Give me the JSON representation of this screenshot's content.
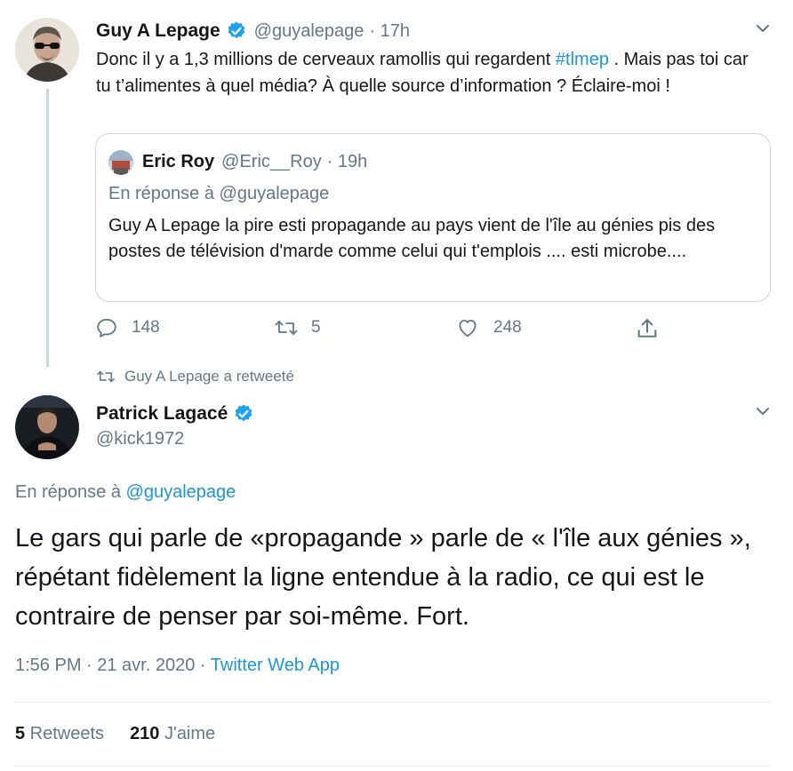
{
  "tweet1": {
    "author_name": "Guy A Lepage",
    "handle": "@guyalepage",
    "time": "· 17h",
    "text_part1": "Donc il y a 1,3 millions de cerveaux ramollis qui regardent ",
    "hashtag": "#tlmep",
    "text_part2": " . Mais pas toi car tu t’alimentes à quel média? À quelle source d’information ? Éclaire-moi !",
    "quote": {
      "author_name": "Eric Roy",
      "handle": "@Eric__Roy",
      "time": "· 19h",
      "reply_to_prefix": "En réponse à ",
      "reply_to_handle": "@guyalepage",
      "text": "Guy A Lepage la pire esti propagande au pays vient de l'île au génies pis des postes de télévision d'marde comme celui qui t'emplois .... esti microbe...."
    },
    "actions": {
      "replies": "148",
      "retweets": "5",
      "likes": "248"
    }
  },
  "retweet_notice": "Guy A Lepage a retweeté",
  "tweet2": {
    "author_name": "Patrick Lagacé",
    "handle": "@kick1972",
    "reply_to_prefix": "En réponse à ",
    "reply_to_handle": "@guyalepage",
    "text": "Le gars qui parle de «propagande » parle de « l'île aux génies », répétant fidèlement la ligne entendue à la radio, ce qui est le contraire de penser par soi-même. Fort.",
    "timestamp": "1:56 PM · 21 avr. 2020 · ",
    "source": "Twitter Web App",
    "retweet_count": "5",
    "retweet_label": " Retweets",
    "like_count": "210",
    "like_label": " J'aime"
  },
  "colors": {
    "accent": "#1b95e0",
    "muted": "#657786",
    "text": "#14171a",
    "border": "#ccd6dd"
  }
}
